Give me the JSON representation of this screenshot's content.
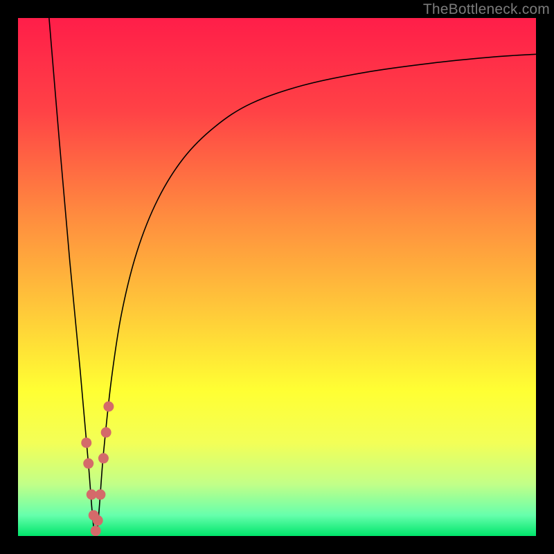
{
  "attribution": "TheBottleneck.com",
  "chart_data": {
    "type": "line",
    "title": "",
    "xlabel": "",
    "ylabel": "",
    "xlim": [
      0,
      100
    ],
    "ylim": [
      0,
      100
    ],
    "x_optimum": 15,
    "series": [
      {
        "name": "bottleneck-curve",
        "x": [
          6,
          8,
          10,
          12,
          13.5,
          15,
          16.5,
          18,
          20,
          23,
          27,
          32,
          38,
          45,
          55,
          67,
          80,
          92,
          100
        ],
        "values": [
          100,
          76,
          53,
          32,
          15,
          0,
          16,
          30,
          43,
          55,
          65,
          73,
          79,
          83.5,
          87,
          89.5,
          91.3,
          92.5,
          93
        ]
      }
    ],
    "markers": {
      "name": "highlight-dots",
      "color": "#d46a6a",
      "points": [
        {
          "x": 13.2,
          "y": 18
        },
        {
          "x": 13.6,
          "y": 14
        },
        {
          "x": 14.2,
          "y": 8
        },
        {
          "x": 14.6,
          "y": 4
        },
        {
          "x": 15.0,
          "y": 1
        },
        {
          "x": 15.4,
          "y": 3
        },
        {
          "x": 15.9,
          "y": 8
        },
        {
          "x": 16.5,
          "y": 15
        },
        {
          "x": 17.0,
          "y": 20
        },
        {
          "x": 17.5,
          "y": 25
        }
      ]
    },
    "gradient_stops": [
      {
        "offset": 0.0,
        "color": "#ff1e49"
      },
      {
        "offset": 0.18,
        "color": "#ff4246"
      },
      {
        "offset": 0.38,
        "color": "#ff8b3f"
      },
      {
        "offset": 0.55,
        "color": "#ffc43a"
      },
      {
        "offset": 0.72,
        "color": "#ffff33"
      },
      {
        "offset": 0.82,
        "color": "#f3ff57"
      },
      {
        "offset": 0.9,
        "color": "#c2ff88"
      },
      {
        "offset": 0.96,
        "color": "#66ffac"
      },
      {
        "offset": 1.0,
        "color": "#00e56b"
      }
    ]
  }
}
